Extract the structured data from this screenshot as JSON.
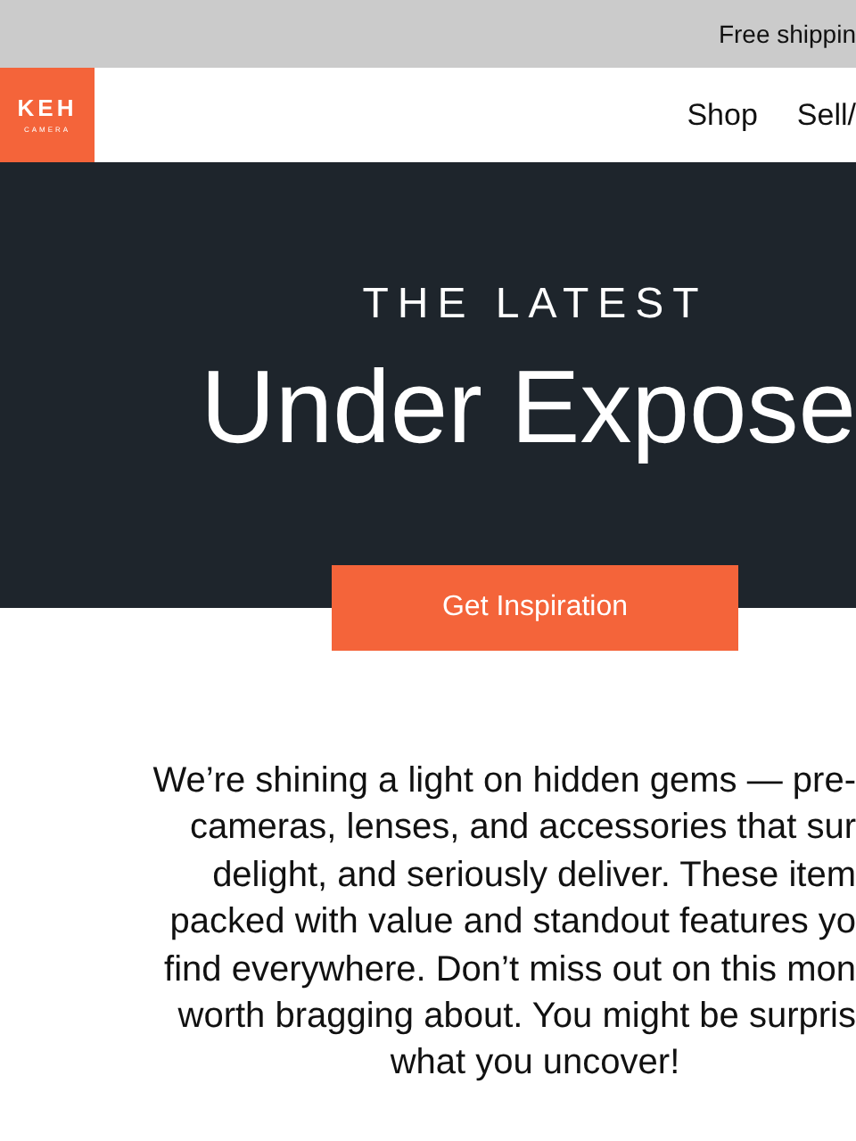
{
  "banner": {
    "text": "Free shippin"
  },
  "header": {
    "logo": {
      "name": "KEH",
      "tagline": "CAMERA"
    },
    "nav": [
      {
        "label": "Shop"
      },
      {
        "label": "Sell/"
      }
    ]
  },
  "hero": {
    "eyebrow": "THE LATEST",
    "title": "Under Expose",
    "button": "Get Inspiration"
  },
  "intro": {
    "lines": [
      "We’re shining a light on hidden gems — pre-",
      "cameras, lenses, and accessories that sur",
      "delight, and seriously deliver. These item",
      "packed with value and standout features yo",
      "find everywhere. Don’t miss out on this mon",
      "worth bragging about. You might be surpris",
      "what you uncover!"
    ]
  }
}
